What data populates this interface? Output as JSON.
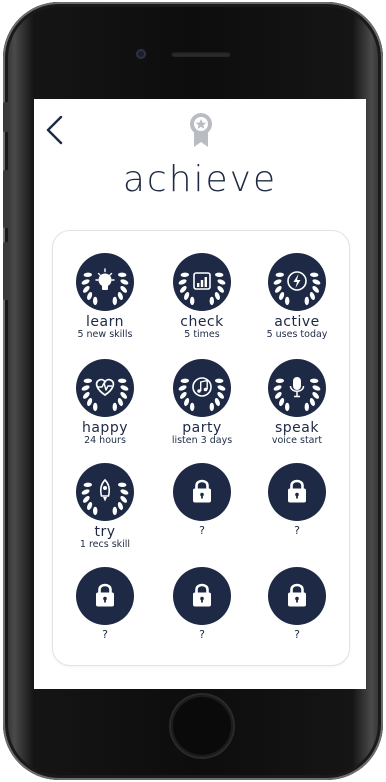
{
  "page": {
    "title": "achieve"
  },
  "colors": {
    "badge": "#1e2a45",
    "background": "#ffffff",
    "card_border": "#e3e3e3"
  },
  "badges": [
    {
      "name": "learn",
      "detail": "5 new skills",
      "icon": "lightbulb-icon"
    },
    {
      "name": "check",
      "detail": "5 times",
      "icon": "bar-chart-icon"
    },
    {
      "name": "active",
      "detail": "5 uses today",
      "icon": "lightning-icon"
    },
    {
      "name": "happy",
      "detail": "24 hours",
      "icon": "heart-pulse-icon"
    },
    {
      "name": "party",
      "detail": "listen 3 days",
      "icon": "music-note-icon"
    },
    {
      "name": "speak",
      "detail": "voice start",
      "icon": "microphone-icon"
    },
    {
      "name": "try",
      "detail": "1 recs skill",
      "icon": "rocket-icon"
    }
  ],
  "locked": [
    {
      "label": "?"
    },
    {
      "label": "?"
    },
    {
      "label": "?"
    },
    {
      "label": "?"
    },
    {
      "label": "?"
    }
  ]
}
